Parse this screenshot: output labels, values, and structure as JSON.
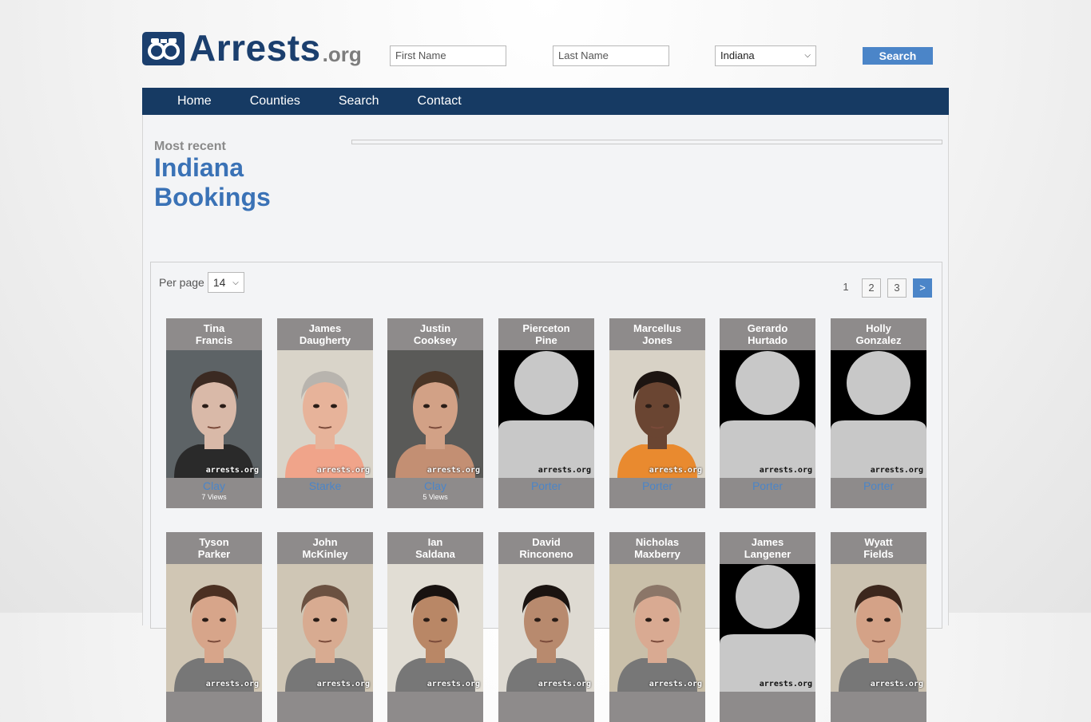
{
  "brand": {
    "name": "Arrests",
    "tld": ".org"
  },
  "search": {
    "first_placeholder": "First Name",
    "last_placeholder": "Last Name",
    "state_selected": "Indiana",
    "button_label": "Search"
  },
  "nav": [
    "Home",
    "Counties",
    "Search",
    "Contact"
  ],
  "page": {
    "eyebrow": "Most recent",
    "title_line1": "Indiana",
    "title_line2": "Bookings"
  },
  "listing": {
    "per_page_label": "Per page",
    "per_page_value": "14",
    "pages": [
      "1",
      "2",
      "3"
    ],
    "next_label": ">"
  },
  "watermark": "arrests.org",
  "people": [
    {
      "first": "Tina",
      "last": "Francis",
      "county": "Clay",
      "views": "7 Views",
      "photo": "photo",
      "skin": "#d9b9a8",
      "hair": "#3b2a22",
      "bg": "#5d6366",
      "shirt": "#2a2a2a"
    },
    {
      "first": "James",
      "last": "Daugherty",
      "county": "Starke",
      "views": "",
      "photo": "photo",
      "skin": "#e7b39a",
      "hair": "#b8b4ae",
      "bg": "#d9d4c9",
      "shirt": "#f0a48a"
    },
    {
      "first": "Justin",
      "last": "Cooksey",
      "county": "Clay",
      "views": "5 Views",
      "photo": "photo",
      "skin": "#d2a186",
      "hair": "#4a3526",
      "bg": "#5a5a58",
      "shirt": "#c38f73"
    },
    {
      "first": "Pierceton",
      "last": "Pine",
      "county": "Porter",
      "views": "",
      "photo": "silhouette"
    },
    {
      "first": "Marcellus",
      "last": "Jones",
      "county": "Porter",
      "views": "",
      "photo": "photo",
      "skin": "#6a4532",
      "hair": "#1c1411",
      "bg": "#d8d2c6",
      "shirt": "#e98a2f"
    },
    {
      "first": "Gerardo",
      "last": "Hurtado",
      "county": "Porter",
      "views": "",
      "photo": "silhouette"
    },
    {
      "first": "Holly",
      "last": "Gonzalez",
      "county": "Porter",
      "views": "",
      "photo": "silhouette"
    },
    {
      "first": "Tyson",
      "last": "Parker",
      "county": "",
      "views": "",
      "photo": "photo",
      "skin": "#d7a58a",
      "hair": "#4b3022",
      "bg": "#d0c6b4",
      "shirt": "#777"
    },
    {
      "first": "John",
      "last": "McKinley",
      "county": "",
      "views": "",
      "photo": "photo",
      "skin": "#d8ab91",
      "hair": "#6b5141",
      "bg": "#cfc6b5",
      "shirt": "#777"
    },
    {
      "first": "Ian",
      "last": "Saldana",
      "county": "",
      "views": "",
      "photo": "photo",
      "skin": "#b98766",
      "hair": "#181210",
      "bg": "#e1ddd4",
      "shirt": "#777"
    },
    {
      "first": "David",
      "last": "Rinconeno",
      "county": "",
      "views": "",
      "photo": "photo",
      "skin": "#b88a6e",
      "hair": "#1a1310",
      "bg": "#dedad2",
      "shirt": "#777"
    },
    {
      "first": "Nicholas",
      "last": "Maxberry",
      "county": "",
      "views": "",
      "photo": "photo",
      "skin": "#d9aa92",
      "hair": "#8b7668",
      "bg": "#c9bfa9",
      "shirt": "#777"
    },
    {
      "first": "James",
      "last": "Langener",
      "county": "",
      "views": "",
      "photo": "silhouette"
    },
    {
      "first": "Wyatt",
      "last": "Fields",
      "county": "",
      "views": "",
      "photo": "photo",
      "skin": "#d4a287",
      "hair": "#3c271d",
      "bg": "#cbc2b1",
      "shirt": "#777"
    }
  ]
}
